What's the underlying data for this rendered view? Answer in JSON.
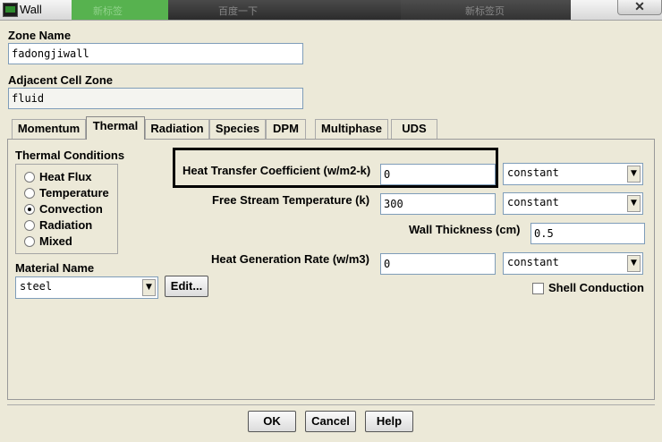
{
  "window": {
    "title": "Wall",
    "close_glyph": "✕",
    "bg_tabs": [
      "新标签",
      "百度一下",
      "新标签页"
    ]
  },
  "zone_name": {
    "label": "Zone Name",
    "value": "fadongjiwall"
  },
  "adjacent_cell_zone": {
    "label": "Adjacent Cell Zone",
    "value": "fluid"
  },
  "tabs": [
    {
      "label": "Momentum"
    },
    {
      "label": "Thermal"
    },
    {
      "label": "Radiation"
    },
    {
      "label": "Species"
    },
    {
      "label": "DPM"
    },
    {
      "label": "Multiphase"
    },
    {
      "label": "UDS"
    }
  ],
  "active_tab": "Thermal",
  "thermal_conditions": {
    "label": "Thermal Conditions",
    "options": [
      "Heat Flux",
      "Temperature",
      "Convection",
      "Radiation",
      "Mixed"
    ],
    "selected": "Convection"
  },
  "material": {
    "label": "Material Name",
    "value": "steel",
    "edit_label": "Edit..."
  },
  "htc": {
    "label": "Heat Transfer Coefficient (w/m2-k)",
    "value": "0",
    "method": "constant"
  },
  "free_stream": {
    "label": "Free Stream Temperature (k)",
    "value": "300",
    "method": "constant"
  },
  "wall_thickness": {
    "label": "Wall Thickness (cm)",
    "value": "0.5"
  },
  "heat_gen": {
    "label": "Heat Generation Rate (w/m3)",
    "value": "0",
    "method": "constant"
  },
  "shell_conduction": {
    "label": "Shell Conduction",
    "checked": false
  },
  "buttons": {
    "ok": "OK",
    "cancel": "Cancel",
    "help": "Help"
  },
  "arrow_glyph": "▼"
}
